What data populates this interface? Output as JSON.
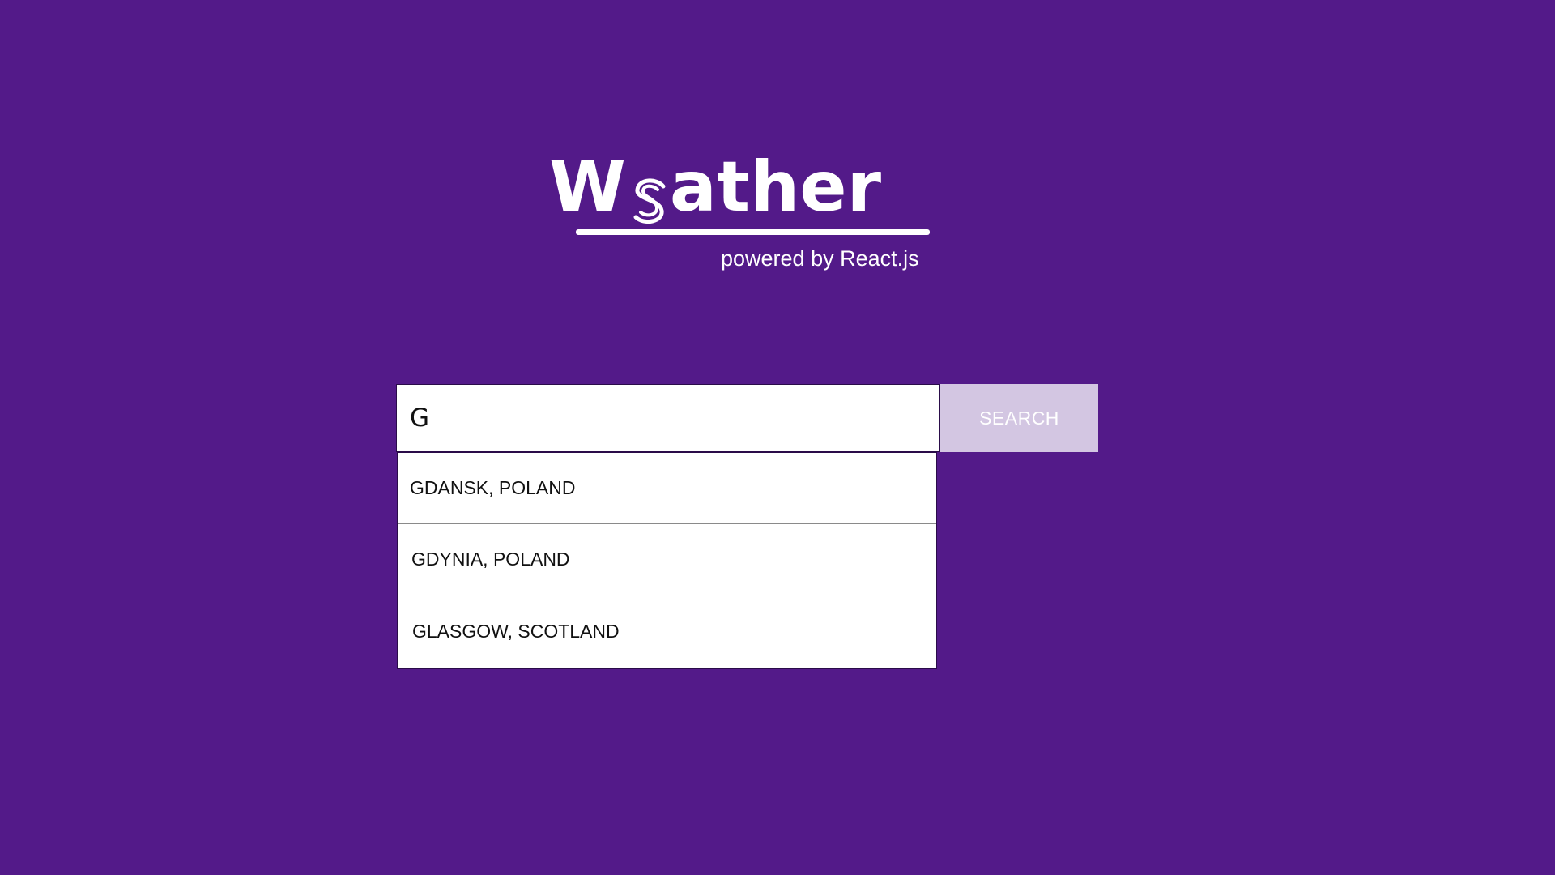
{
  "header": {
    "logo": {
      "first_letter": "W",
      "rest": "ather",
      "mark_icon": "swirl-icon"
    },
    "tagline": "powered by React.js"
  },
  "search": {
    "value": "G",
    "placeholder": "",
    "button_label": "SEARCH"
  },
  "suggestions": [
    {
      "label": "GDANSK, POLAND"
    },
    {
      "label": "GDYNIA, POLAND"
    },
    {
      "label": "GLASGOW, SCOTLAND"
    }
  ],
  "colors": {
    "background": "#531a89",
    "button": "#d3c6e2",
    "text_light": "#ffffff"
  }
}
